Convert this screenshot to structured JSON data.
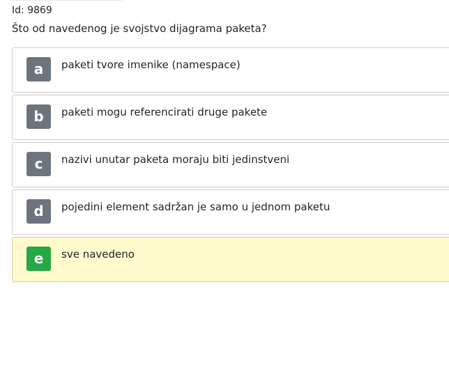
{
  "question": {
    "id_label": "Id: 9869",
    "text": "Što od navedenog je svojstvo dijagrama paketa?"
  },
  "answers": [
    {
      "letter": "a",
      "text": "paketi tvore imenike (namespace)",
      "state": "default"
    },
    {
      "letter": "b",
      "text": "paketi mogu referencirati druge pakete",
      "state": "default"
    },
    {
      "letter": "c",
      "text": "nazivi unutar paketa moraju biti jedinstveni",
      "state": "default"
    },
    {
      "letter": "d",
      "text": "pojedini element sadržan je samo u jednom paketu",
      "state": "default"
    },
    {
      "letter": "e",
      "text": "sve navedeno",
      "state": "selected-correct"
    }
  ],
  "colors": {
    "letter_default": "#6c757d",
    "letter_correct": "#28a745",
    "selected_background": "#fff9cc",
    "border": "#cfcfcf"
  }
}
